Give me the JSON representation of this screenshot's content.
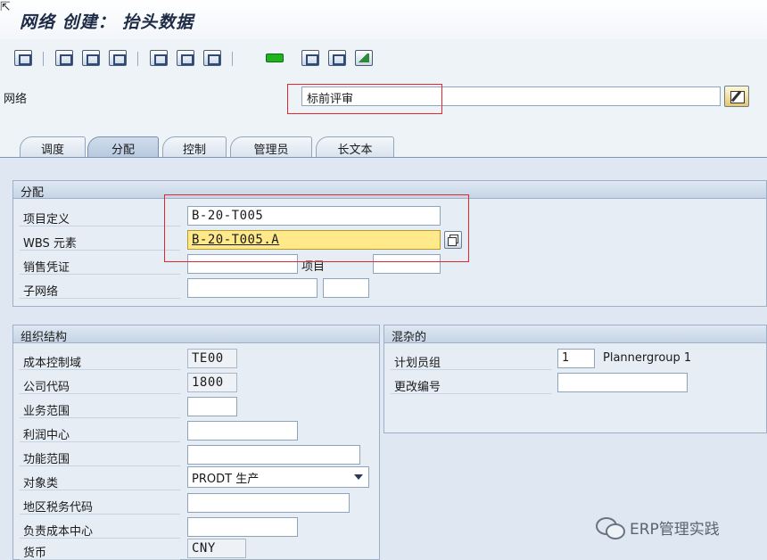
{
  "window": {
    "title": "网络 创建： 抬头数据"
  },
  "header": {
    "network_label": "网络",
    "network_value": "标前评审"
  },
  "tabs": [
    {
      "label": "调度",
      "active": false
    },
    {
      "label": "分配",
      "active": true
    },
    {
      "label": "控制",
      "active": false
    },
    {
      "label": "管理员",
      "active": false
    },
    {
      "label": "长文本",
      "active": false
    }
  ],
  "assignment": {
    "title": "分配",
    "project_def_label": "项目定义",
    "project_def_value": "B-20-T005",
    "wbs_label": "WBS 元素",
    "wbs_value": "B-20-T005.A",
    "sales_doc_label": "销售凭证",
    "sales_doc_value": "",
    "item_label": "项目",
    "item_value": "",
    "subnetwork_label": "子网络",
    "subnetwork_value": ""
  },
  "org": {
    "title": "组织结构",
    "controlling_area_label": "成本控制域",
    "controlling_area_value": "TE00",
    "company_code_label": "公司代码",
    "company_code_value": "1800",
    "business_area_label": "业务范围",
    "business_area_value": "",
    "profit_center_label": "利润中心",
    "profit_center_value": "",
    "functional_area_label": "功能范围",
    "functional_area_value": "",
    "object_class_label": "对象类",
    "object_class_value": "PRODT 生产",
    "tax_jurisdiction_label": "地区税务代码",
    "tax_jurisdiction_value": "",
    "resp_cost_center_label": "负责成本中心",
    "resp_cost_center_value": "",
    "currency_label": "货币",
    "currency_value": "CNY"
  },
  "misc": {
    "title": "混杂的",
    "planner_group_label": "计划员组",
    "planner_group_value": "1",
    "planner_group_text": "Plannergroup 1",
    "change_number_label": "更改编号",
    "change_number_value": ""
  },
  "watermark": {
    "text": "ERP管理实践"
  },
  "colors": {
    "highlight": "#ffe98a",
    "annotation_red": "#e0282e",
    "toolbar_green": "#1fb31f"
  }
}
